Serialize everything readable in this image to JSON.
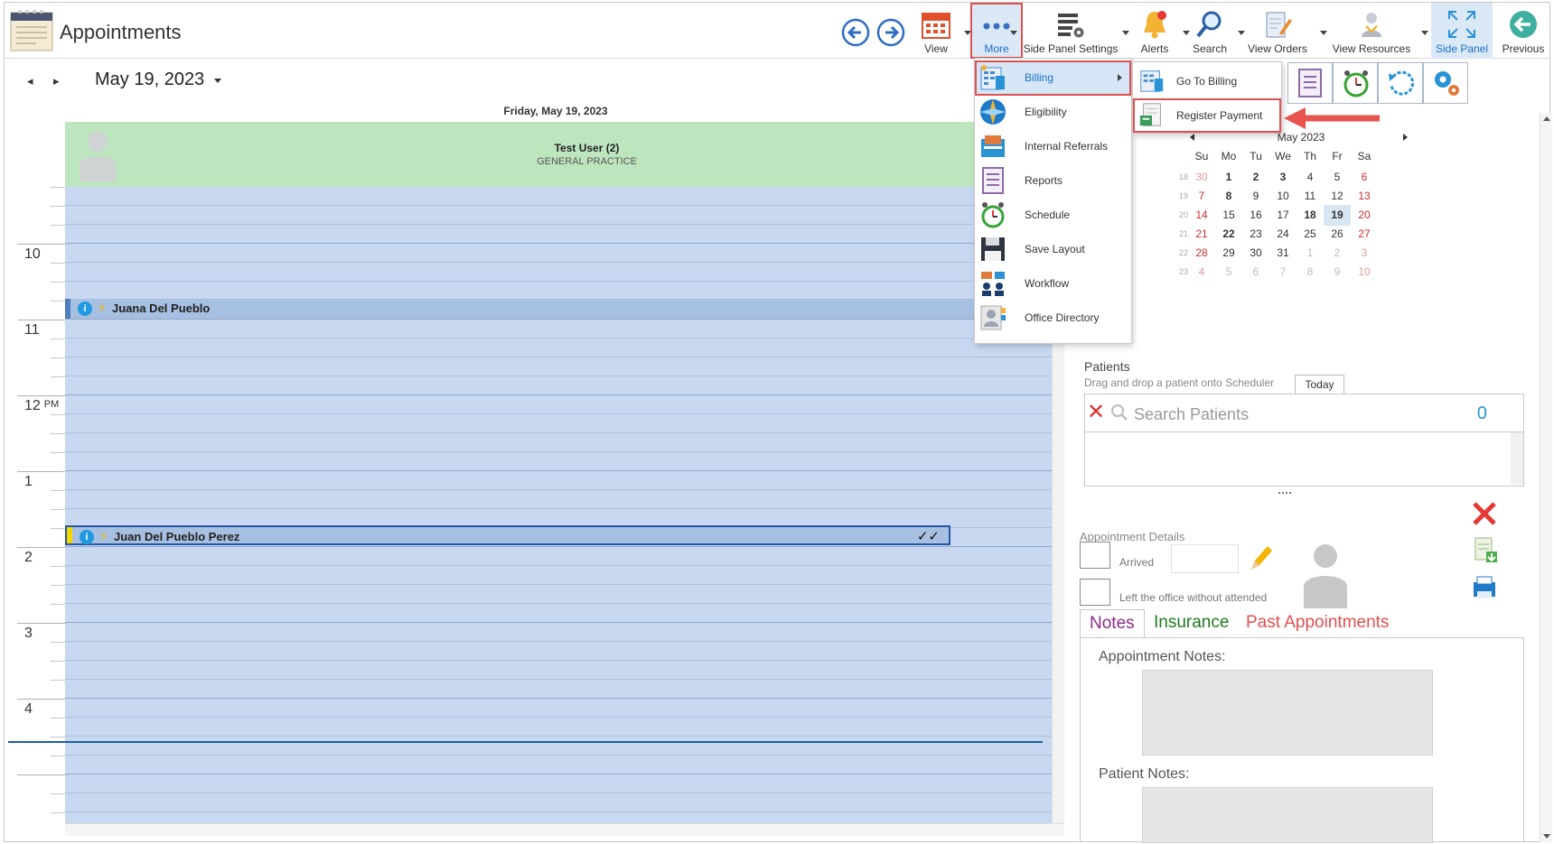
{
  "window": {
    "title": "Appointments"
  },
  "toolbar": {
    "view_label": "View",
    "more_label": "More",
    "side_panel_settings_label": "Side Panel Settings",
    "alerts_label": "Alerts",
    "search_label": "Search",
    "view_orders_label": "View Orders",
    "view_resources_label": "View Resources",
    "side_panel_label": "Side Panel",
    "previous_label": "Previous"
  },
  "date_header": {
    "current_date": "May 19, 2023",
    "day_title": "Friday, May 19, 2023"
  },
  "resource": {
    "name": "Test User (2)",
    "department": "GENERAL PRACTICE"
  },
  "time_labels": {
    "t10": "10",
    "t11": "11",
    "t12": "12",
    "t12_suffix": "PM",
    "t1": "1",
    "t2": "2",
    "t3": "3",
    "t4": "4"
  },
  "appointments": [
    {
      "patient": "Juana Del Pueblo",
      "start": "11:00"
    },
    {
      "patient": "Juan Del Pueblo Perez",
      "start": "2:00",
      "status": "✓✓"
    }
  ],
  "more_menu": {
    "items": [
      {
        "label": "Billing",
        "icon": "billing-icon"
      },
      {
        "label": "Eligibility",
        "icon": "eligibility-icon"
      },
      {
        "label": "Internal Referrals",
        "icon": "referrals-icon"
      },
      {
        "label": "Reports",
        "icon": "reports-icon"
      },
      {
        "label": "Schedule",
        "icon": "alarm-clock-icon"
      },
      {
        "label": "Save Layout",
        "icon": "floppy-disk-icon"
      },
      {
        "label": "Workflow",
        "icon": "workflow-icon"
      },
      {
        "label": "Office Directory",
        "icon": "directory-icon"
      }
    ],
    "billing_submenu": [
      {
        "label": "Go To Billing",
        "icon": "billing-icon"
      },
      {
        "label": "Register Payment",
        "icon": "register-payment-icon"
      }
    ]
  },
  "mini_calendar": {
    "title": "May 2023",
    "dow": [
      "Su",
      "Mo",
      "Tu",
      "We",
      "Th",
      "Fr",
      "Sa"
    ],
    "weeks": [
      {
        "wk": "18",
        "days": [
          "30",
          "1",
          "2",
          "3",
          "4",
          "5",
          "6"
        ]
      },
      {
        "wk": "19",
        "days": [
          "7",
          "8",
          "9",
          "10",
          "11",
          "12",
          "13"
        ]
      },
      {
        "wk": "20",
        "days": [
          "14",
          "15",
          "16",
          "17",
          "18",
          "19",
          "20"
        ]
      },
      {
        "wk": "21",
        "days": [
          "21",
          "22",
          "23",
          "24",
          "25",
          "26",
          "27"
        ]
      },
      {
        "wk": "22",
        "days": [
          "28",
          "29",
          "30",
          "31",
          "1",
          "2",
          "3"
        ]
      },
      {
        "wk": "23",
        "days": [
          "4",
          "5",
          "6",
          "7",
          "8",
          "9",
          "10"
        ]
      }
    ],
    "selected_day": "19",
    "today_label": "Today"
  },
  "patients": {
    "label": "Patients",
    "hint": "Drag and drop a patient onto Scheduler",
    "search_placeholder": "Search Patients",
    "count": "0"
  },
  "appointment_details": {
    "label": "Appointment Details",
    "arrived_label": "Arrived",
    "left_label": "Left the office without attended"
  },
  "tabs": {
    "notes": "Notes",
    "insurance": "Insurance",
    "past": "Past Appointments"
  },
  "notes": {
    "appointment_notes_label": "Appointment Notes:",
    "patient_notes_label": "Patient Notes:"
  },
  "colors": {
    "accent": "#1a6fc7",
    "highlight_red": "#e05252",
    "resource_header": "#bde5be",
    "grid": "#c7d8f0"
  }
}
